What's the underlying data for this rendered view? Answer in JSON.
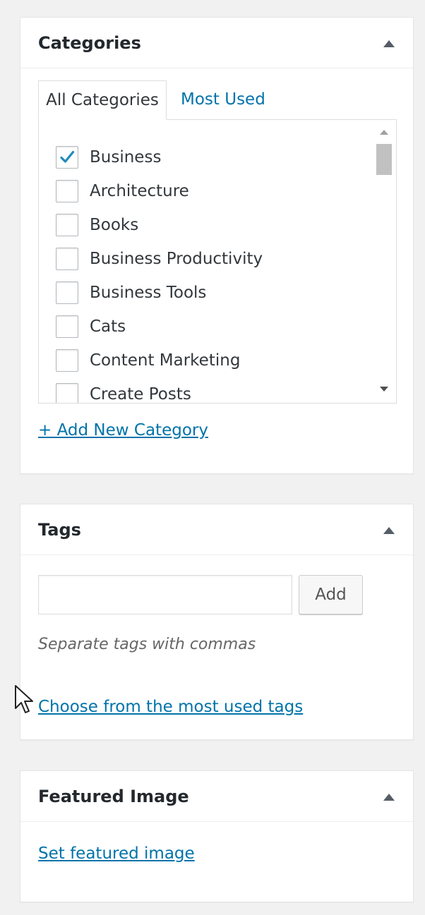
{
  "categories": {
    "title": "Categories",
    "tabs": [
      {
        "label": "All Categories",
        "active": true
      },
      {
        "label": "Most Used",
        "active": false
      }
    ],
    "items": [
      {
        "label": "Business",
        "checked": true
      },
      {
        "label": "Architecture",
        "checked": false
      },
      {
        "label": "Books",
        "checked": false
      },
      {
        "label": "Business Productivity",
        "checked": false
      },
      {
        "label": "Business Tools",
        "checked": false
      },
      {
        "label": "Cats",
        "checked": false
      },
      {
        "label": "Content Marketing",
        "checked": false
      },
      {
        "label": "Create Posts",
        "checked": false
      }
    ],
    "add_new_label": "+ Add New Category"
  },
  "tags": {
    "title": "Tags",
    "input_value": "",
    "add_button_label": "Add",
    "hint": "Separate tags with commas",
    "choose_label": "Choose from the most used tags"
  },
  "featured_image": {
    "title": "Featured Image",
    "set_label": "Set featured image"
  },
  "icons": {
    "panel_toggle": "triangle-up-icon",
    "checkmark": "checkmark-icon",
    "cursor": "mouse-pointer-icon"
  },
  "colors": {
    "link": "#0073aa",
    "background": "#f1f1f1",
    "panel": "#ffffff",
    "border": "#e5e5e5",
    "text": "#23282d"
  }
}
